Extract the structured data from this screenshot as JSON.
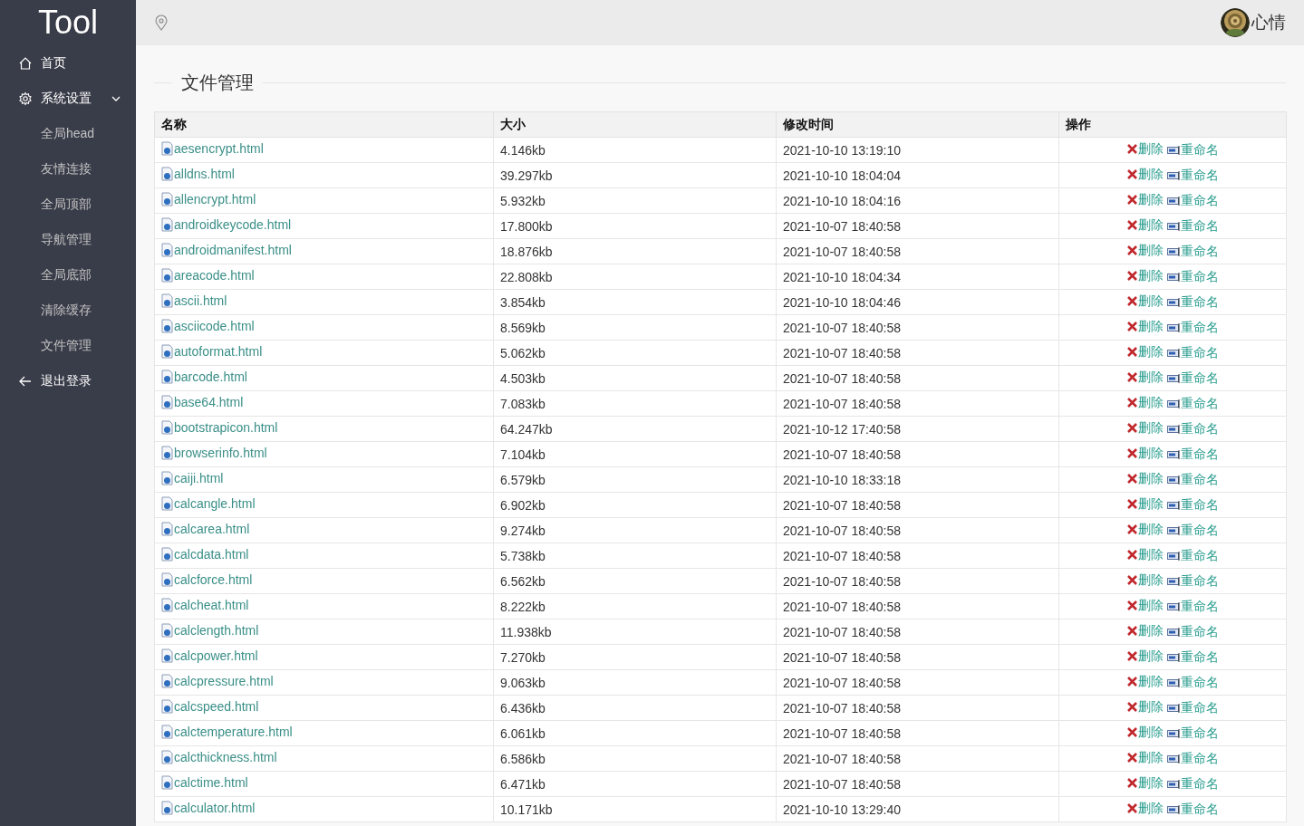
{
  "sidebar": {
    "logo": "Tool",
    "items": [
      {
        "label": "首页",
        "kind": "home"
      },
      {
        "label": "系统设置",
        "kind": "settings",
        "expanded": true,
        "children": [
          {
            "label": "全局head"
          },
          {
            "label": "友情连接"
          },
          {
            "label": "全局顶部"
          },
          {
            "label": "导航管理"
          },
          {
            "label": "全局底部"
          },
          {
            "label": "清除缓存"
          },
          {
            "label": "文件管理"
          }
        ]
      },
      {
        "label": "退出登录",
        "kind": "logout"
      }
    ]
  },
  "header": {
    "user": "心情"
  },
  "page_title": "文件管理",
  "table": {
    "columns": [
      "名称",
      "大小",
      "修改时间",
      "操作"
    ],
    "rows": [
      {
        "name": "aesencrypt.html",
        "size": "4.146kb",
        "modified": "2021-10-10 13:19:10",
        "delete": "删除",
        "rename": "重命名"
      },
      {
        "name": "alldns.html",
        "size": "39.297kb",
        "modified": "2021-10-10 18:04:04",
        "delete": "删除",
        "rename": "重命名"
      },
      {
        "name": "allencrypt.html",
        "size": "5.932kb",
        "modified": "2021-10-10 18:04:16",
        "delete": "删除",
        "rename": "重命名"
      },
      {
        "name": "androidkeycode.html",
        "size": "17.800kb",
        "modified": "2021-10-07 18:40:58",
        "delete": "删除",
        "rename": "重命名"
      },
      {
        "name": "androidmanifest.html",
        "size": "18.876kb",
        "modified": "2021-10-07 18:40:58",
        "delete": "删除",
        "rename": "重命名"
      },
      {
        "name": "areacode.html",
        "size": "22.808kb",
        "modified": "2021-10-10 18:04:34",
        "delete": "删除",
        "rename": "重命名"
      },
      {
        "name": "ascii.html",
        "size": "3.854kb",
        "modified": "2021-10-10 18:04:46",
        "delete": "删除",
        "rename": "重命名"
      },
      {
        "name": "asciicode.html",
        "size": "8.569kb",
        "modified": "2021-10-07 18:40:58",
        "delete": "删除",
        "rename": "重命名"
      },
      {
        "name": "autoformat.html",
        "size": "5.062kb",
        "modified": "2021-10-07 18:40:58",
        "delete": "删除",
        "rename": "重命名"
      },
      {
        "name": "barcode.html",
        "size": "4.503kb",
        "modified": "2021-10-07 18:40:58",
        "delete": "删除",
        "rename": "重命名"
      },
      {
        "name": "base64.html",
        "size": "7.083kb",
        "modified": "2021-10-07 18:40:58",
        "delete": "删除",
        "rename": "重命名"
      },
      {
        "name": "bootstrapicon.html",
        "size": "64.247kb",
        "modified": "2021-10-12 17:40:58",
        "delete": "删除",
        "rename": "重命名"
      },
      {
        "name": "browserinfo.html",
        "size": "7.104kb",
        "modified": "2021-10-07 18:40:58",
        "delete": "删除",
        "rename": "重命名"
      },
      {
        "name": "caiji.html",
        "size": "6.579kb",
        "modified": "2021-10-10 18:33:18",
        "delete": "删除",
        "rename": "重命名"
      },
      {
        "name": "calcangle.html",
        "size": "6.902kb",
        "modified": "2021-10-07 18:40:58",
        "delete": "删除",
        "rename": "重命名"
      },
      {
        "name": "calcarea.html",
        "size": "9.274kb",
        "modified": "2021-10-07 18:40:58",
        "delete": "删除",
        "rename": "重命名"
      },
      {
        "name": "calcdata.html",
        "size": "5.738kb",
        "modified": "2021-10-07 18:40:58",
        "delete": "删除",
        "rename": "重命名"
      },
      {
        "name": "calcforce.html",
        "size": "6.562kb",
        "modified": "2021-10-07 18:40:58",
        "delete": "删除",
        "rename": "重命名"
      },
      {
        "name": "calcheat.html",
        "size": "8.222kb",
        "modified": "2021-10-07 18:40:58",
        "delete": "删除",
        "rename": "重命名"
      },
      {
        "name": "calclength.html",
        "size": "11.938kb",
        "modified": "2021-10-07 18:40:58",
        "delete": "删除",
        "rename": "重命名"
      },
      {
        "name": "calcpower.html",
        "size": "7.270kb",
        "modified": "2021-10-07 18:40:58",
        "delete": "删除",
        "rename": "重命名"
      },
      {
        "name": "calcpressure.html",
        "size": "9.063kb",
        "modified": "2021-10-07 18:40:58",
        "delete": "删除",
        "rename": "重命名"
      },
      {
        "name": "calcspeed.html",
        "size": "6.436kb",
        "modified": "2021-10-07 18:40:58",
        "delete": "删除",
        "rename": "重命名"
      },
      {
        "name": "calctemperature.html",
        "size": "6.061kb",
        "modified": "2021-10-07 18:40:58",
        "delete": "删除",
        "rename": "重命名"
      },
      {
        "name": "calcthickness.html",
        "size": "6.586kb",
        "modified": "2021-10-07 18:40:58",
        "delete": "删除",
        "rename": "重命名"
      },
      {
        "name": "calctime.html",
        "size": "6.471kb",
        "modified": "2021-10-07 18:40:58",
        "delete": "删除",
        "rename": "重命名"
      },
      {
        "name": "calculator.html",
        "size": "10.171kb",
        "modified": "2021-10-10 13:29:40",
        "delete": "删除",
        "rename": "重命名"
      }
    ]
  }
}
